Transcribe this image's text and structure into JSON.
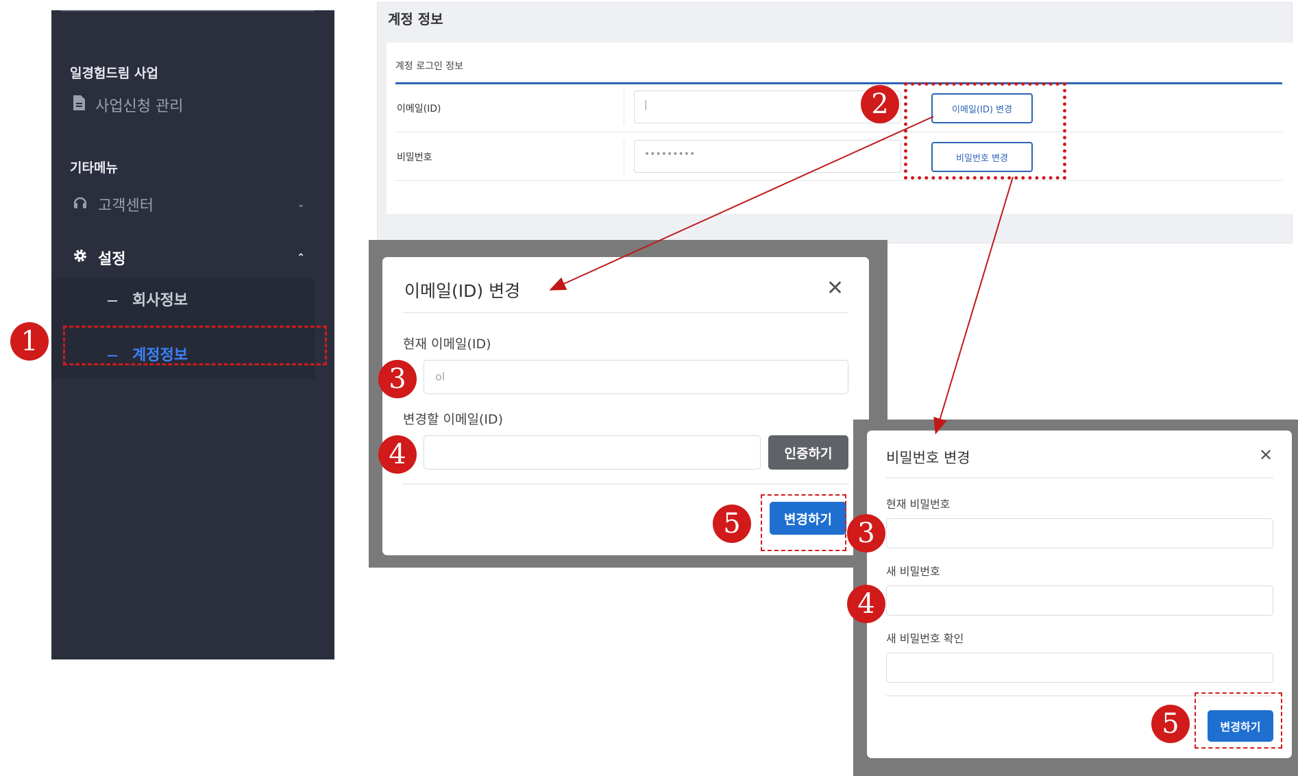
{
  "sidebar": {
    "section1": "일경험드림 사업",
    "item_apply": "사업신청 관리",
    "section2": "기타메뉴",
    "item_support": "고객센터",
    "item_settings": "설정",
    "sub_company": "회사정보",
    "sub_account": "계정정보"
  },
  "account_panel": {
    "title": "계정 정보",
    "subtitle": "계정 로그인 정보",
    "email_label": "이메일(ID)",
    "email_value": "|",
    "email_button": "이메일(ID) 변경",
    "password_label": "비밀번호",
    "password_value": "•••••••••",
    "password_button": "비밀번호 변경"
  },
  "email_modal": {
    "title": "이메일(ID) 변경",
    "close": "✕",
    "current_label": "현재 이메일(ID)",
    "current_value": "ol",
    "new_label": "변경할 이메일(ID)",
    "new_value": "",
    "verify_button": "인증하기",
    "submit_button": "변경하기"
  },
  "password_modal": {
    "title": "비밀번호 변경",
    "close": "✕",
    "current_label": "현재 비밀번호",
    "new_label": "새 비밀번호",
    "confirm_label": "새 비밀번호 확인",
    "submit_button": "변경하기"
  },
  "annotations": {
    "step1": "1",
    "step2": "2",
    "email_step3": "3",
    "email_step4": "4",
    "email_step5": "5",
    "pw_step3": "3",
    "pw_step4": "4",
    "pw_step5": "5"
  },
  "icons": {
    "apply": "document-icon",
    "support": "headset-icon",
    "settings": "gear-icon",
    "expand": "chevron-down-icon",
    "collapse": "chevron-up-icon",
    "close": "close-icon"
  },
  "colors": {
    "sidebar_bg": "#2b2f3d",
    "active_menu": "#3b82f6",
    "primary_button": "#1f6fd1",
    "annotation_red": "#d11a1a"
  }
}
